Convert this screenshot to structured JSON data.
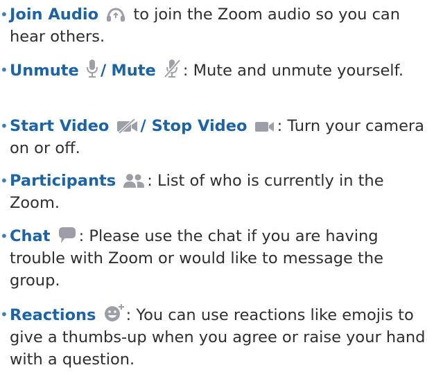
{
  "colors": {
    "term": "#1c64a6",
    "bullet": "#3a7fc1",
    "icon": "#9d9fa8",
    "text": "#2e2e2e"
  },
  "items": [
    {
      "term": "Join Audio",
      "icon": "headphones-icon",
      "text": " to join the Zoom audio so you can hear others."
    },
    {
      "term": "Unmute",
      "icon": "microphone-icon",
      "separator": "/",
      "term2": "Mute",
      "icon2": "microphone-muted-icon",
      "text": ": Mute and unmute yourself."
    },
    {
      "term": "Start Video",
      "icon": "video-off-icon",
      "term2": "/ Stop Video",
      "icon2": "video-camera-icon",
      "text": ": Turn your camera on or off."
    },
    {
      "term": "Participants",
      "icon": "participants-icon",
      "text": ": List of who is currently in the Zoom."
    },
    {
      "term": "Chat",
      "icon": "chat-bubble-icon",
      "text": ": Please use the chat if you are having trouble with Zoom or would like to message the group."
    },
    {
      "term": "Reactions",
      "icon": "emoji-reaction-icon",
      "text": ": You can use reactions like emojis to give a thumbs-up when you agree or raise your hand with a question."
    }
  ]
}
